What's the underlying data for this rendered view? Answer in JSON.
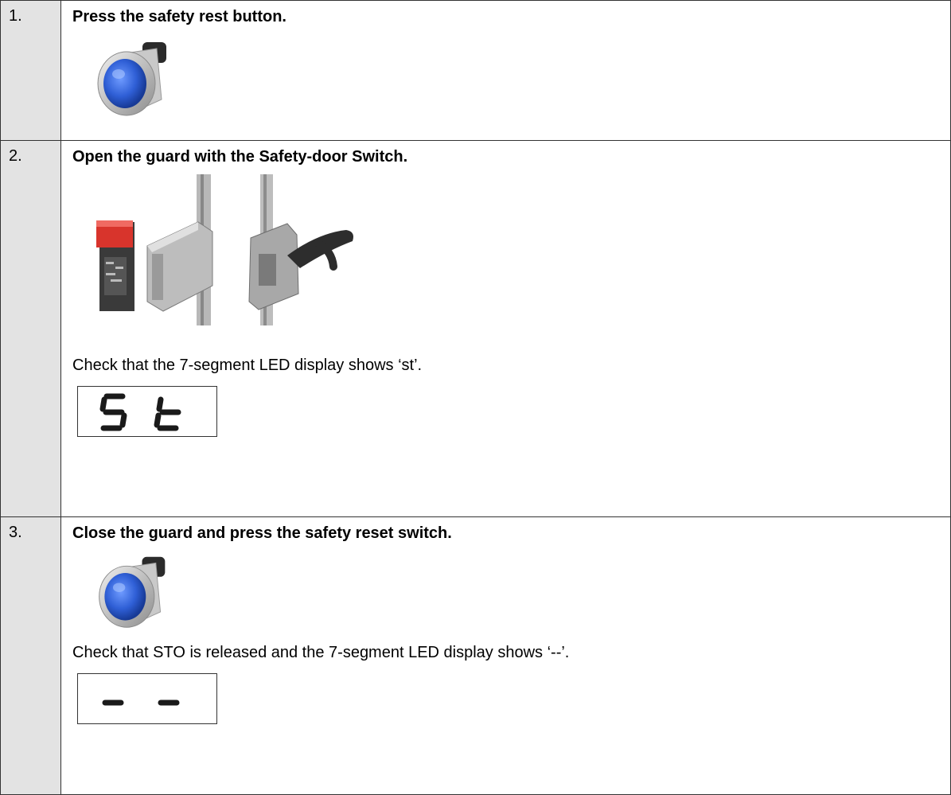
{
  "steps": [
    {
      "number": "1.",
      "heading": "Press the safety rest button.",
      "image": "safety-reset-pushbutton-icon"
    },
    {
      "number": "2.",
      "heading": "Open the guard with the Safety-door Switch.",
      "image": "safety-door-switch-icon",
      "check_text": "Check that the 7-segment LED display shows ‘st’.",
      "display": "St"
    },
    {
      "number": "3.",
      "heading": "Close the guard and press the safety reset switch.",
      "image": "safety-reset-pushbutton-icon",
      "check_text": "Check that STO is released and the 7-segment LED display shows ‘--’.",
      "display": "--"
    }
  ],
  "colors": {
    "number_cell_bg": "#e3e3e3",
    "button_blue": "#2f5fd6",
    "switch_red": "#d8342c"
  }
}
